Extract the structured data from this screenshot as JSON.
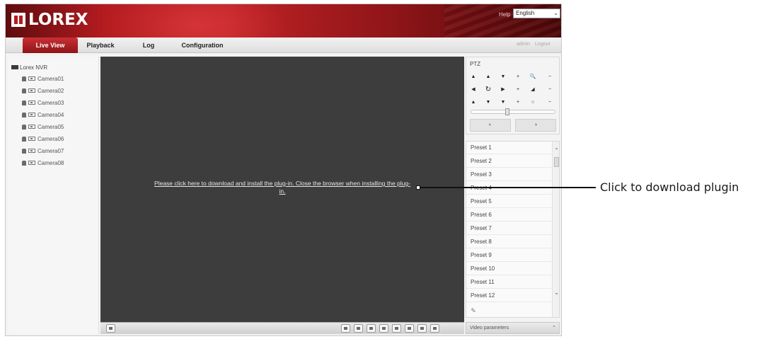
{
  "header": {
    "logo_text": "LOREX",
    "help_label": "Help",
    "language": "English"
  },
  "nav": {
    "tabs": [
      {
        "label": "Live View"
      },
      {
        "label": "Playback"
      },
      {
        "label": "Log"
      },
      {
        "label": "Configuration"
      }
    ],
    "user_links": [
      "admin",
      "Logout"
    ]
  },
  "tree": {
    "root": "Lorex NVR",
    "cameras": [
      "Camera01",
      "Camera02",
      "Camera03",
      "Camera04",
      "Camera05",
      "Camera06",
      "Camera07",
      "Camera08"
    ]
  },
  "video": {
    "plugin_message": "Please click here to download and install the plug-in. Close the browser when installing the plug-in."
  },
  "ptz": {
    "title": "PTZ",
    "rows": [
      [
        "▲",
        "▲",
        "▼",
        "+",
        "🔍",
        "−"
      ],
      [
        "◀",
        "↻",
        "▶",
        "+",
        "◢",
        "−"
      ],
      [
        "▲",
        "▼",
        "▼",
        "+",
        "○",
        "−"
      ]
    ]
  },
  "presets": [
    "Preset 1",
    "Preset 2",
    "Preset 3",
    "Preset 4",
    "Preset 5",
    "Preset 6",
    "Preset 7",
    "Preset 8",
    "Preset 9",
    "Preset 10",
    "Preset 11",
    "Preset 12"
  ],
  "footer": {
    "video_params_label": "Video parameters"
  },
  "callout": {
    "label": "Click to download plugin"
  },
  "colors": {
    "brand_red": "#b51c20",
    "video_bg": "#3d3d3d"
  }
}
